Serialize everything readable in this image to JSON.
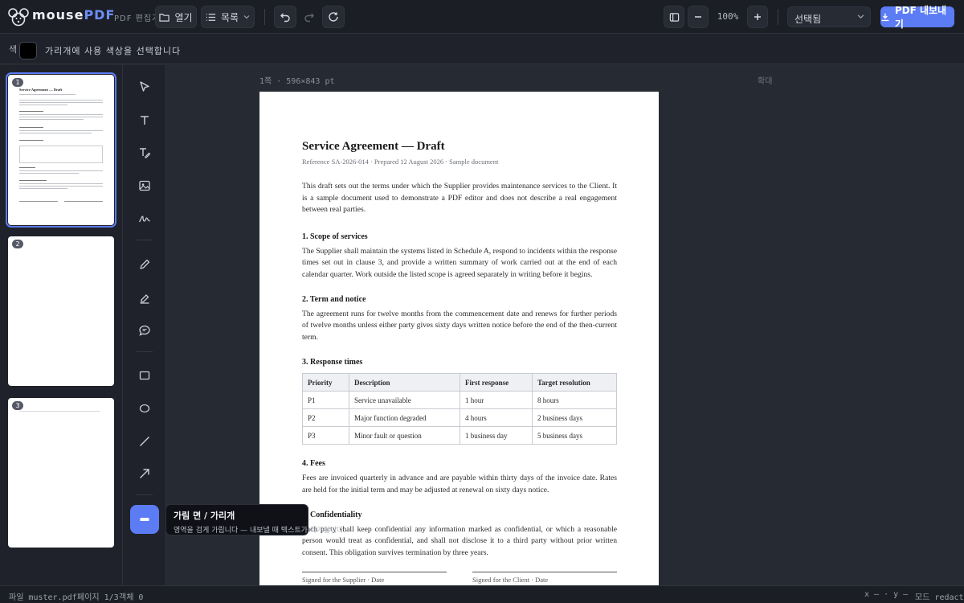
{
  "app": {
    "brand_main": "mouse",
    "brand_accent": "PDF",
    "brand_sub": "PDF 편집기"
  },
  "toolbar": {
    "open_label": "열기",
    "pages_label": "목록",
    "zoom_value": "100%",
    "mode_select": "선택됨",
    "export_label": "PDF 내보내기"
  },
  "subbar": {
    "glyph": "색",
    "text": "가리개에 사용 색상을 선택합니다",
    "swatch_color": "#000000"
  },
  "thumbnails": [
    {
      "number": "1",
      "title": "Service Agreement — Draft"
    },
    {
      "number": "2"
    },
    {
      "number": "3"
    }
  ],
  "canvas": {
    "page_meta": "1쪽 · 596×843 pt",
    "page_meta_right": "확대"
  },
  "document": {
    "title": "Service Agreement — Draft",
    "reference": "Reference SA-2026-014 · Prepared 12 August 2026 · Sample document",
    "intro": "This draft sets out the terms under which the Supplier provides maintenance services to the Client. It is a sample document used to demonstrate a PDF editor and does not describe a real engagement between real parties.",
    "sections": [
      {
        "heading": "1. Scope of services",
        "body": "The Supplier shall maintain the systems listed in Schedule A, respond to incidents within the response times set out in clause 3, and provide a written summary of work carried out at the end of each calendar quarter. Work outside the listed scope is agreed separately in writing before it begins."
      },
      {
        "heading": "2. Term and notice",
        "body": "The agreement runs for twelve months from the commencement date and renews for further periods of twelve months unless either party gives sixty days written notice before the end of the then-current term."
      },
      {
        "heading": "3. Response times"
      },
      {
        "heading": "4. Fees",
        "body": "Fees are invoiced quarterly in advance and are payable within thirty days of the invoice date. Rates are held for the initial term and may be adjusted at renewal on sixty days notice."
      },
      {
        "heading": "5. Confidentiality",
        "body": "Each party shall keep confidential any information marked as confidential, or which a reasonable person would treat as confidential, and shall not disclose it to a third party without prior written consent. This obligation survives termination by three years."
      }
    ],
    "table": {
      "headers": [
        "Priority",
        "Description",
        "First response",
        "Target resolution"
      ],
      "rows": [
        [
          "P1",
          "Service unavailable",
          "1 hour",
          "8 hours"
        ],
        [
          "P2",
          "Major function degraded",
          "4 hours",
          "2 business days"
        ],
        [
          "P3",
          "Minor fault or question",
          "1 business day",
          "5 business days"
        ]
      ]
    },
    "signature_supplier": "Signed for the Supplier · Date",
    "signature_client": "Signed for the Client · Date"
  },
  "tooltip": {
    "title": "가림 면 / 가리개",
    "description": "영역을 검게 가립니다 — 내보낼 때 텍스트가 제거됩니다."
  },
  "status": {
    "file": "파일 muster.pdf",
    "page": "페이지 1/3",
    "objects": "객체 0",
    "coords": "x — · y —",
    "mode": "모드 redact"
  },
  "colors": {
    "accent": "#5b7cf5",
    "background": "#262a33",
    "panel": "#1f222a"
  }
}
